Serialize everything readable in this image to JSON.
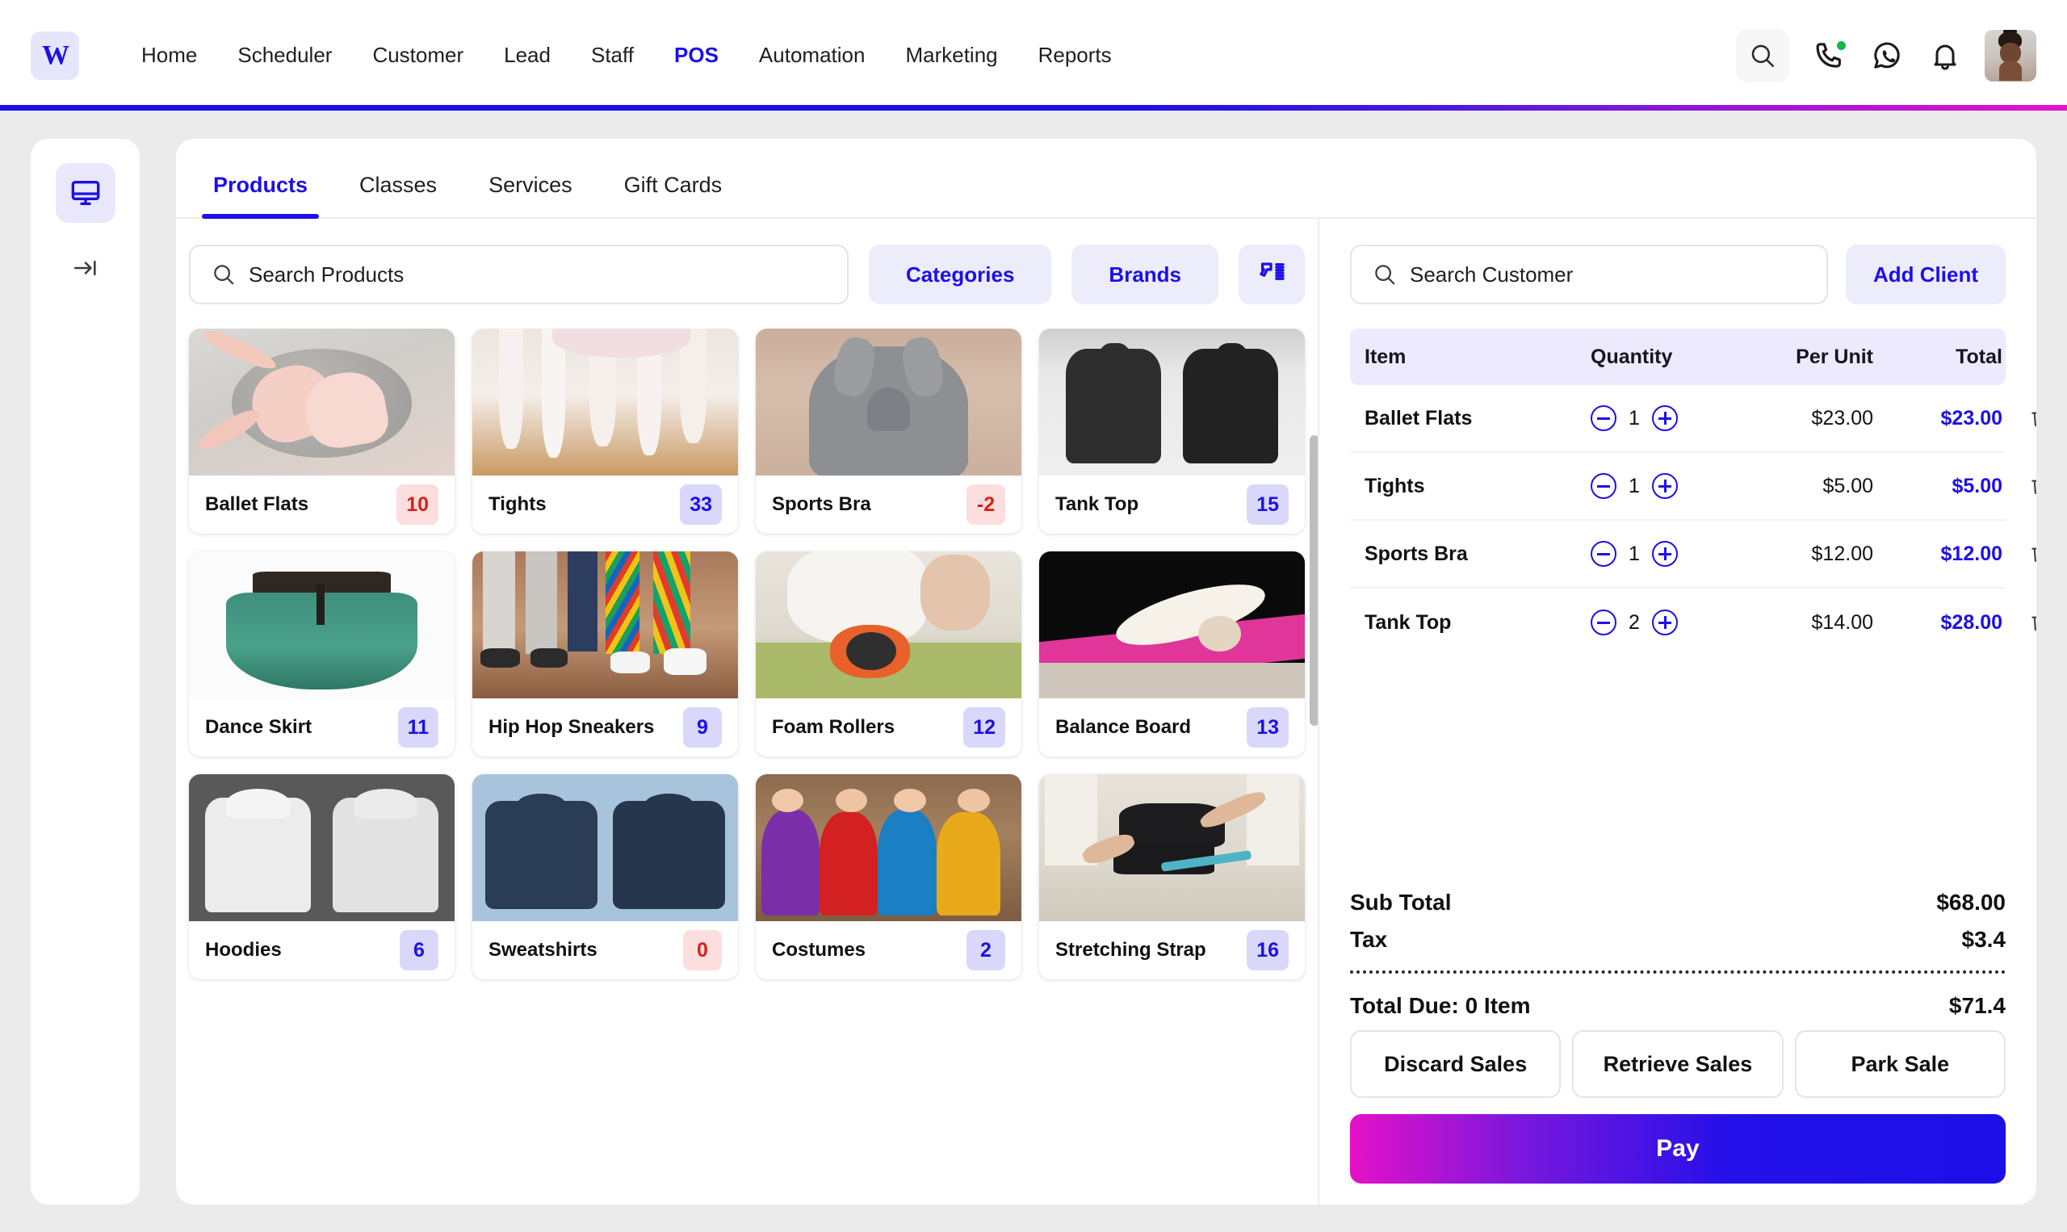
{
  "brand": {
    "logo_text": "W",
    "accent": "#1d0fe8",
    "accent_magenta": "#e811c9"
  },
  "nav": {
    "items": [
      {
        "label": "Home",
        "active": false
      },
      {
        "label": "Scheduler",
        "active": false
      },
      {
        "label": "Customer",
        "active": false
      },
      {
        "label": "Lead",
        "active": false
      },
      {
        "label": "Staff",
        "active": false
      },
      {
        "label": "POS",
        "active": true
      },
      {
        "label": "Automation",
        "active": false
      },
      {
        "label": "Marketing",
        "active": false
      },
      {
        "label": "Reports",
        "active": false
      }
    ],
    "icons": [
      "search-icon",
      "phone-icon",
      "whatsapp-icon",
      "bell-icon",
      "avatar"
    ]
  },
  "rail": {
    "items": [
      "monitor-icon",
      "collapse-arrow-icon"
    ]
  },
  "tabs": [
    {
      "label": "Products",
      "active": true
    },
    {
      "label": "Classes",
      "active": false
    },
    {
      "label": "Services",
      "active": false
    },
    {
      "label": "Gift Cards",
      "active": false
    }
  ],
  "filters": {
    "search_placeholder": "Search Products",
    "search_value": "",
    "categories_label": "Categories",
    "brands_label": "Brands",
    "scanner_icon": "barcode-scanner-icon"
  },
  "products": [
    {
      "name": "Ballet Flats",
      "stock": "10",
      "stock_state": "low",
      "img": "ballet-flats"
    },
    {
      "name": "Tights",
      "stock": "33",
      "stock_state": "ok",
      "img": "tights"
    },
    {
      "name": "Sports Bra",
      "stock": "-2",
      "stock_state": "low",
      "img": "sports-bra"
    },
    {
      "name": "Tank Top",
      "stock": "15",
      "stock_state": "ok",
      "img": "tank-top"
    },
    {
      "name": "Dance Skirt",
      "stock": "11",
      "stock_state": "ok",
      "img": "dance-skirt"
    },
    {
      "name": "Hip Hop Sneakers",
      "stock": "9",
      "stock_state": "ok",
      "img": "hip-hop-sneakers"
    },
    {
      "name": "Foam Rollers",
      "stock": "12",
      "stock_state": "ok",
      "img": "foam-rollers"
    },
    {
      "name": "Balance Board",
      "stock": "13",
      "stock_state": "ok",
      "img": "balance-board"
    },
    {
      "name": "Hoodies",
      "stock": "6",
      "stock_state": "ok",
      "img": "hoodies"
    },
    {
      "name": "Sweatshirts",
      "stock": "0",
      "stock_state": "low",
      "img": "sweatshirts"
    },
    {
      "name": "Costumes",
      "stock": "2",
      "stock_state": "ok",
      "img": "costumes"
    },
    {
      "name": "Stretching Strap",
      "stock": "16",
      "stock_state": "ok",
      "img": "stretching-strap"
    }
  ],
  "cart": {
    "customer_search_placeholder": "Search Customer",
    "customer_search_value": "",
    "add_client_label": "Add Client",
    "columns": [
      "Item",
      "Quantity",
      "Per Unit",
      "Total"
    ],
    "rows": [
      {
        "item": "Ballet Flats",
        "qty": "1",
        "per_unit": "$23.00",
        "total": "$23.00"
      },
      {
        "item": "Tights",
        "qty": "1",
        "per_unit": "$5.00",
        "total": "$5.00"
      },
      {
        "item": "Sports Bra",
        "qty": "1",
        "per_unit": "$12.00",
        "total": "$12.00"
      },
      {
        "item": "Tank Top",
        "qty": "2",
        "per_unit": "$14.00",
        "total": "$28.00"
      }
    ],
    "subtotal_label": "Sub Total",
    "subtotal_value": "$68.00",
    "tax_label": "Tax",
    "tax_value": "$3.4",
    "total_due_label": "Total Due: 0 Item",
    "total_due_value": "$71.4",
    "actions": [
      "Discard Sales",
      "Retrieve Sales",
      "Park Sale"
    ],
    "pay_label": "Pay"
  }
}
